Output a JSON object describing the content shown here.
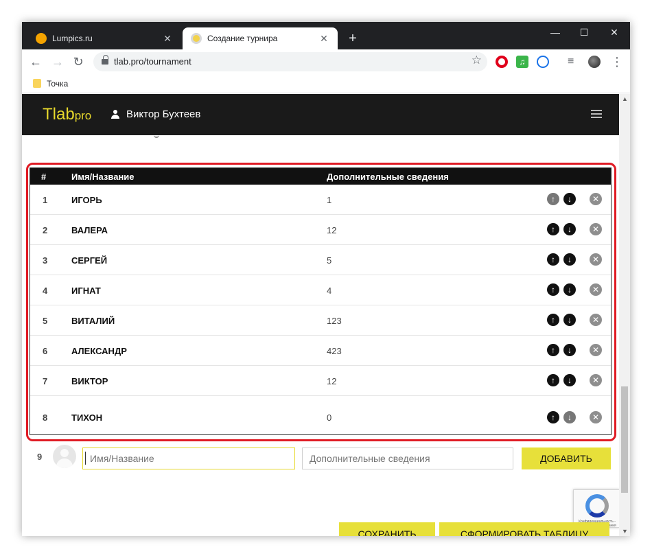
{
  "browser": {
    "tabs": [
      {
        "label": "Lumpics.ru",
        "close": "✕"
      },
      {
        "label": "Создание турнира",
        "close": "✕"
      }
    ],
    "new_tab": "+",
    "window_controls": {
      "minimize": "—",
      "maximize": "☐",
      "close": "✕"
    },
    "nav": {
      "back": "←",
      "forward": "→",
      "reload": "↻"
    },
    "url": "tlab.pro/tournament",
    "star": "☆",
    "extensions": [
      "opera-icon",
      "music-icon",
      "vpn-icon",
      "queue-icon",
      "profile-avatar",
      "menu-icon"
    ],
    "music_glyph": "♫",
    "queue_glyph": "≡",
    "menu_glyph": "⋮",
    "bookmark_label": "Точка"
  },
  "site": {
    "logo_main": "Tlab",
    "logo_sub": "pro",
    "user_name": "Виктор Бухтеев",
    "brand_color": "#e7d82c"
  },
  "table": {
    "headers": {
      "num": "#",
      "name": "Имя/Название",
      "info": "Дополнительные сведения"
    },
    "rows": [
      {
        "num": "1",
        "name": "ИГОРЬ",
        "info": "1"
      },
      {
        "num": "2",
        "name": "ВАЛЕРА",
        "info": "12"
      },
      {
        "num": "3",
        "name": "СЕРГЕЙ",
        "info": "5"
      },
      {
        "num": "4",
        "name": "ИГНАТ",
        "info": "4"
      },
      {
        "num": "5",
        "name": "ВИТАЛИЙ",
        "info": "123"
      },
      {
        "num": "6",
        "name": "АЛЕКСАНДР",
        "info": "423"
      },
      {
        "num": "7",
        "name": "ВИКТОР",
        "info": "12"
      },
      {
        "num": "8",
        "name": "ТИХОН",
        "info": "0"
      }
    ],
    "up_glyph": "↑",
    "down_glyph": "↓",
    "remove_glyph": "✕"
  },
  "add_form": {
    "num": "9",
    "name_placeholder": "Имя/Название",
    "info_placeholder": "Дополнительные сведения",
    "add_label": "ДОБАВИТЬ"
  },
  "footer": {
    "save_label": "СОХРАНИТЬ",
    "form_table_label": "СФОРМИРОВАТЬ ТАБЛИЦУ",
    "recaptcha_text": "Конфиденциальность - Условия использования"
  }
}
